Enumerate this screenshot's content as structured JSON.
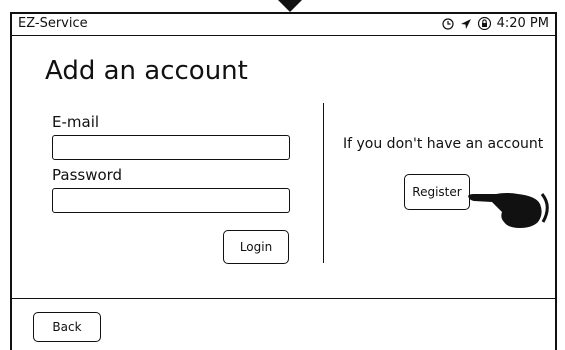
{
  "status_bar": {
    "app_name": "EZ-Service",
    "time": "4:20 PM",
    "icons": [
      "clock-icon",
      "location-arrow-icon",
      "lock-icon"
    ]
  },
  "page": {
    "title": "Add an account"
  },
  "login_form": {
    "email_label": "E-mail",
    "email_value": "",
    "password_label": "Password",
    "password_value": "",
    "login_label": "Login"
  },
  "register_panel": {
    "prompt": "If you don't have an account",
    "register_label": "Register"
  },
  "footer": {
    "back_label": "Back"
  },
  "annotations": {
    "pointer": "hand-pointer-icon"
  }
}
